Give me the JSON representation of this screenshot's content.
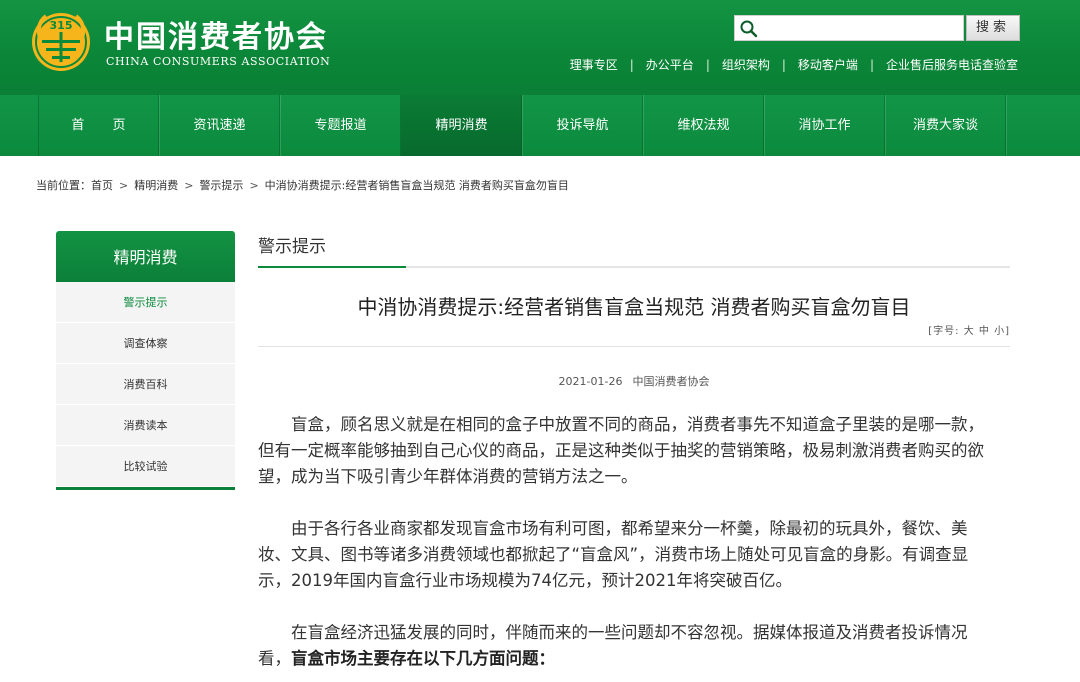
{
  "header": {
    "logo_cn": "中国消费者协会",
    "logo_en": "CHINA CONSUMERS ASSOCIATION",
    "logo_emblem_text": "315",
    "search": {
      "placeholder": "",
      "button": "搜索"
    },
    "top_links": [
      "理事专区",
      "办公平台",
      "组织架构",
      "移动客户端",
      "企业售后服务电话查验室"
    ]
  },
  "nav": {
    "items": [
      {
        "label": "首页",
        "display": "首 页"
      },
      {
        "label": "资讯速递"
      },
      {
        "label": "专题报道"
      },
      {
        "label": "精明消费",
        "active": true
      },
      {
        "label": "投诉导航"
      },
      {
        "label": "维权法规"
      },
      {
        "label": "消协工作"
      },
      {
        "label": "消费大家谈"
      }
    ]
  },
  "breadcrumb": {
    "prefix": "当前位置：",
    "items": [
      "首页",
      "精明消费",
      "警示提示",
      "中消协消费提示:经营者销售盲盒当规范 消费者购买盲盒勿盲目"
    ],
    "separator": ">"
  },
  "sidebar": {
    "title": "精明消费",
    "items": [
      {
        "label": "警示提示",
        "active": true
      },
      {
        "label": "调查体察"
      },
      {
        "label": "消费百科"
      },
      {
        "label": "消费读本"
      },
      {
        "label": "比较试验"
      }
    ]
  },
  "main": {
    "section_title": "警示提示",
    "article_title": "中消协消费提示:经营者销售盲盒当规范 消费者购买盲盒勿盲目",
    "font_size_control": "[字号: 大 中 小]",
    "date": "2021-01-26",
    "source": "中国消费者协会",
    "paragraphs": [
      {
        "text": "盲盒，顾名思义就是在相同的盒子中放置不同的商品，消费者事先不知道盒子里装的是哪一款，但有一定概率能够抽到自己心仪的商品，正是这种类似于抽奖的营销策略，极易刺激消费者购买的欲望，成为当下吸引青少年群体消费的营销方法之一。"
      },
      {
        "text": "由于各行各业商家都发现盲盒市场有利可图，都希望来分一杯羹，除最初的玩具外，餐饮、美妆、文具、图书等诸多消费领域也都掀起了“盲盒风”，消费市场上随处可见盲盒的身影。有调查显示，2019年国内盲盒行业市场规模为74亿元，预计2021年将突破百亿。"
      },
      {
        "text": "在盲盒经济迅猛发展的同时，伴随而来的一些问题却不容忽视。据媒体报道及消费者投诉情况看，",
        "bold": "盲盒市场主要存在以下几方面问题："
      }
    ]
  },
  "colors": {
    "brand_green": "#0b8a3c",
    "brand_green_dark": "#076a2d",
    "logo_gold": "#f5b51b"
  }
}
